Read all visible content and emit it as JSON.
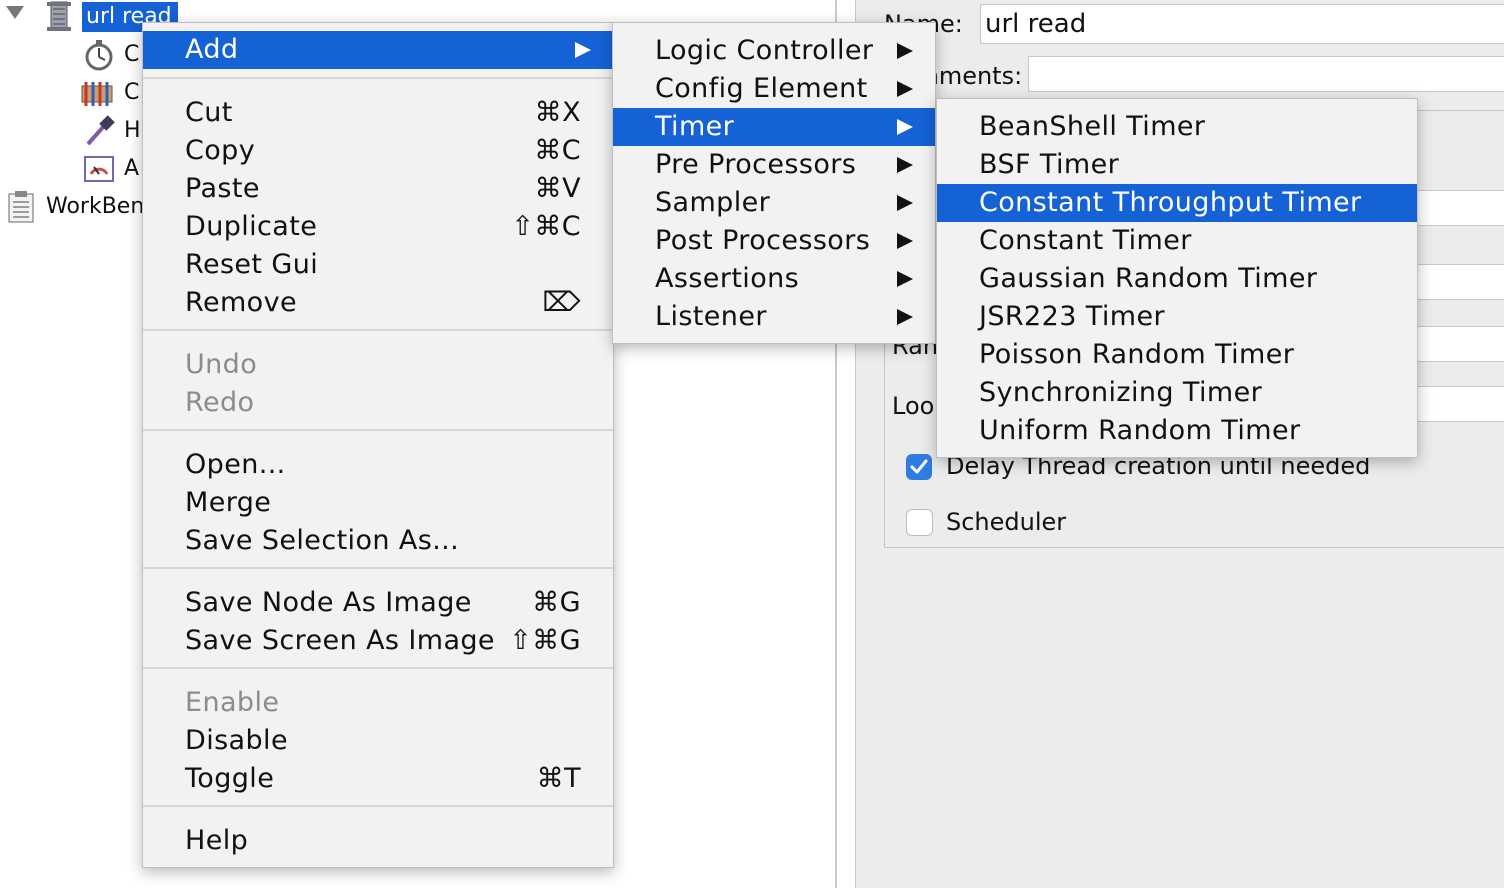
{
  "tree": {
    "root_label": "url read",
    "children": [
      {
        "label": "C",
        "icon": "stopwatch-icon"
      },
      {
        "label": "C",
        "icon": "config-csv-icon"
      },
      {
        "label": "H",
        "icon": "pipette-icon"
      },
      {
        "label": "A",
        "icon": "gauge-icon"
      }
    ],
    "workbench_label": "WorkBenc",
    "workbench_icon": "clipboard-icon"
  },
  "right_panel": {
    "name_label": "Name:",
    "name_value": "url read",
    "comments_label": "Comments:",
    "ramp_label": "Ran",
    "loop_label": "Loo",
    "delay_label": "Delay Thread creation until needed",
    "delay_checked": true,
    "scheduler_label": "Scheduler",
    "scheduler_checked": false
  },
  "context_menu": {
    "items": [
      {
        "label": "Add",
        "submenu": true,
        "highlighted": true
      },
      {
        "label": "Cut",
        "shortcut": "⌘X"
      },
      {
        "label": "Copy",
        "shortcut": "⌘C"
      },
      {
        "label": "Paste",
        "shortcut": "⌘V"
      },
      {
        "label": "Duplicate",
        "shortcut": "⇧⌘C"
      },
      {
        "label": "Reset Gui",
        "shortcut": ""
      },
      {
        "label": "Remove",
        "shortcut": "⌦"
      },
      {
        "label": "Undo",
        "disabled": true
      },
      {
        "label": "Redo",
        "disabled": true
      },
      {
        "label": "Open..."
      },
      {
        "label": "Merge"
      },
      {
        "label": "Save Selection As..."
      },
      {
        "label": "Save Node As Image",
        "shortcut": "⌘G"
      },
      {
        "label": "Save Screen As Image",
        "shortcut": "⇧⌘G"
      },
      {
        "label": "Enable",
        "disabled": true
      },
      {
        "label": "Disable"
      },
      {
        "label": "Toggle",
        "shortcut": "⌘T"
      },
      {
        "label": "Help"
      }
    ]
  },
  "add_submenu": {
    "items": [
      {
        "label": "Logic Controller"
      },
      {
        "label": "Config Element"
      },
      {
        "label": "Timer",
        "highlighted": true
      },
      {
        "label": "Pre Processors"
      },
      {
        "label": "Sampler"
      },
      {
        "label": "Post Processors"
      },
      {
        "label": "Assertions"
      },
      {
        "label": "Listener"
      }
    ]
  },
  "timer_submenu": {
    "items": [
      {
        "label": "BeanShell Timer"
      },
      {
        "label": "BSF Timer"
      },
      {
        "label": "Constant Throughput Timer",
        "highlighted": true
      },
      {
        "label": "Constant Timer"
      },
      {
        "label": "Gaussian Random Timer"
      },
      {
        "label": "JSR223 Timer"
      },
      {
        "label": "Poisson Random Timer"
      },
      {
        "label": "Synchronizing Timer"
      },
      {
        "label": "Uniform Random Timer"
      }
    ]
  },
  "colors": {
    "highlight": "#1462d6",
    "menu_bg": "#f2f2f2",
    "checkbox_on": "#2f7de1"
  }
}
